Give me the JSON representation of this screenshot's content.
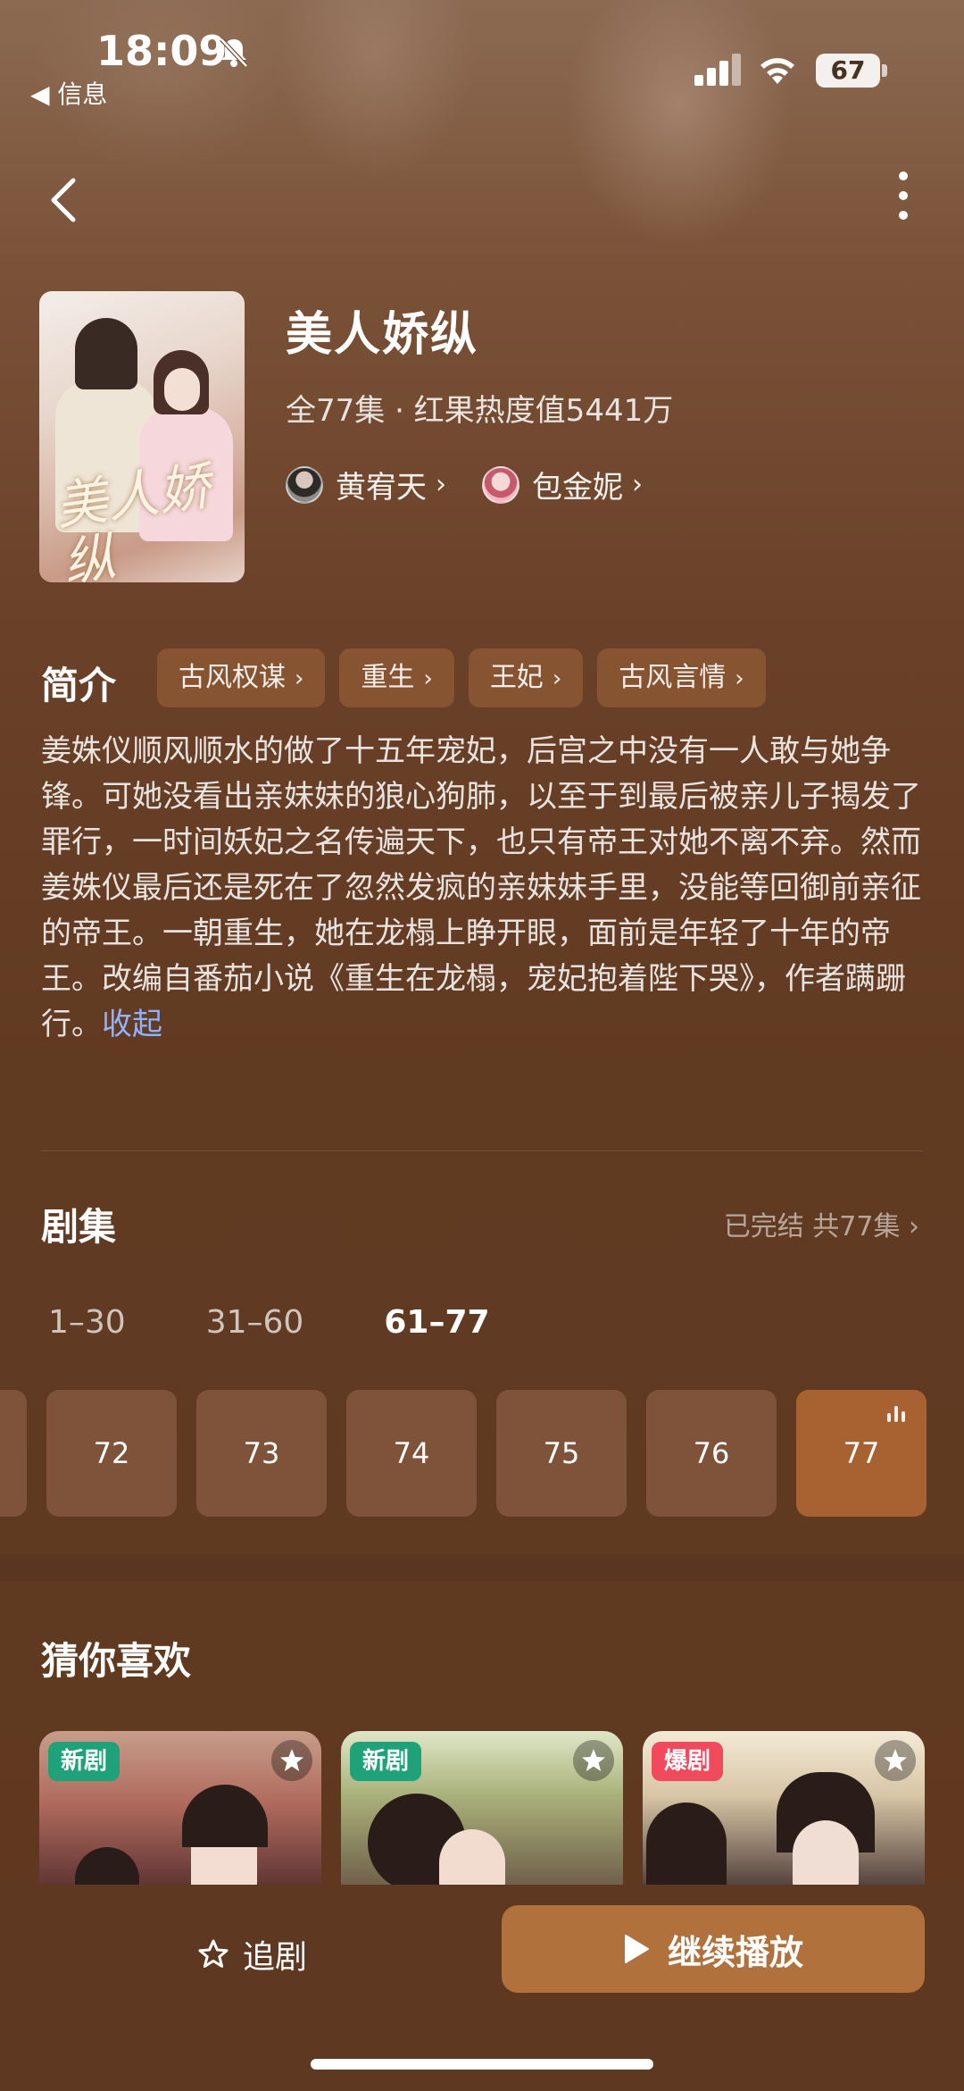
{
  "status_bar": {
    "time": "18:09",
    "back_app": "◀ 信息",
    "battery": "67"
  },
  "drama": {
    "title": "美人娇纵",
    "poster_text": "美人娇纵",
    "meta": "全77集 · 红果热度值5441万",
    "actors": [
      {
        "name": "黄宥天"
      },
      {
        "name": "包金妮"
      }
    ]
  },
  "intro": {
    "heading": "简介",
    "tags": [
      "古风权谋",
      "重生",
      "王妃",
      "古风言情"
    ],
    "description": "姜姝仪顺风顺水的做了十五年宠妃，后宫之中没有一人敢与她争锋。可她没看出亲妹妹的狼心狗肺，以至于到最后被亲儿子揭发了罪行，一时间妖妃之名传遍天下，也只有帝王对她不离不弃。然而姜姝仪最后还是死在了忽然发疯的亲妹妹手里，没能等回御前亲征的帝王。一朝重生，她在龙榻上睁开眼，面前是年轻了十年的帝王。改编自番茄小说《重生在龙榻，宠妃抱着陛下哭》，作者蹒跚行。",
    "collapse_label": "收起"
  },
  "episodes": {
    "heading": "剧集",
    "status": "已完结 共77集",
    "ranges": [
      "1–30",
      "31–60",
      "61–77"
    ],
    "active_range": 2,
    "items": [
      "72",
      "73",
      "74",
      "75",
      "76",
      "77"
    ],
    "current": "77"
  },
  "recommendations": {
    "heading": "猜你喜欢",
    "cards": [
      {
        "badge": "新剧",
        "badge_type": "new"
      },
      {
        "badge": "新剧",
        "badge_type": "new"
      },
      {
        "badge": "爆剧",
        "badge_type": "hot"
      }
    ]
  },
  "bottom_bar": {
    "follow_label": "追剧",
    "play_label": "继续播放"
  },
  "colors": {
    "background": "#5e3820",
    "accent": "#b0713d",
    "link": "#8fb4ff",
    "badge_new": "#1fa27a",
    "badge_hot": "#f04a5c"
  }
}
